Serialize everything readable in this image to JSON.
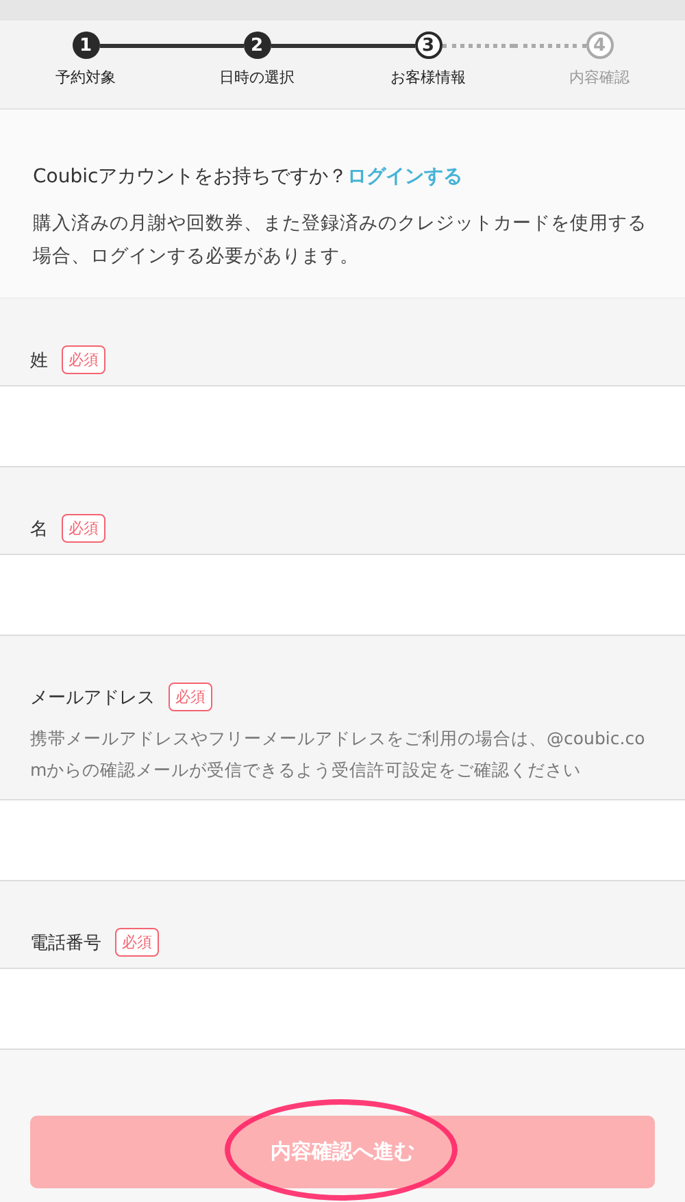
{
  "steps": [
    {
      "number": "1",
      "label": "予約対象",
      "completed": true,
      "selected": false
    },
    {
      "number": "2",
      "label": "日時の選択",
      "completed": true,
      "selected": false
    },
    {
      "number": "3",
      "label": "お客様情報",
      "completed": false,
      "selected": true
    },
    {
      "number": "4",
      "label": "内容確認",
      "completed": false,
      "selected": false
    }
  ],
  "login_notice": {
    "question": "Coubicアカウントをお持ちですか？",
    "link": "ログインする",
    "description": "購入済みの月謝や回数券、また登録済みのクレジットカードを使用する場合、ログインする必要があります。"
  },
  "fields": [
    {
      "label": "姓",
      "badge": "必須"
    },
    {
      "label": "名",
      "badge": "必須"
    },
    {
      "label": "メールアドレス",
      "badge": "必須",
      "hint": "携帯メールアドレスやフリーメールアドレスをご利用の場合は、@coubic.comからの確認メールが受信できるよう受信許可設定をご確認ください"
    },
    {
      "label": "電話番号",
      "badge": "必須"
    }
  ],
  "submit_button": {
    "label": "内容確認へ進む",
    "disabled": true,
    "highlighted": true
  }
}
